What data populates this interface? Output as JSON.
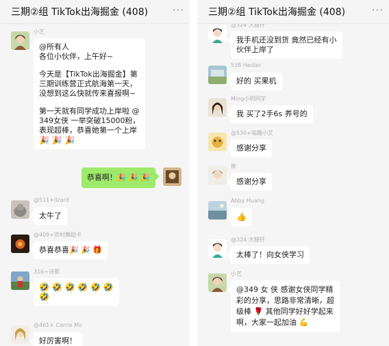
{
  "left": {
    "title": "三期②组 TikTok出海掘金 (408)",
    "more_label": "···",
    "messages": [
      {
        "sender": "小艺",
        "lines": [
          "@所有人",
          "各位小伙伴，上午好~",
          "",
          "今天是【TikTok出海掘金】第",
          "三期训练营正式航海第一天，",
          "没想到这么快就传来喜报啊~",
          "",
          "第一天就有同学成功上岸啦 @",
          "349女侠 一举突破15000粉，",
          "表现超棒，恭喜她第一个上岸"
        ],
        "emoji": "🎉 🎉 🎉"
      },
      {
        "text": "恭喜啊！🎉 🎉 🎉"
      },
      {
        "sender": "@511+lizard",
        "text": "太牛了"
      },
      {
        "sender": "@409+农村舞蹈卡",
        "text": "恭喜恭喜🎉 🎉 🎁"
      },
      {
        "sender": "316+诗那",
        "line1": "🤣 🤣 🤣 🤣 🤣 🤣",
        "line2": "🤣"
      },
      {
        "sender": "@461+ Carrie Mo",
        "text": "好厉害啊！"
      }
    ]
  },
  "right": {
    "title": "三期②组 TikTok出海掘金 (408)",
    "more_label": "···",
    "messages": [
      {
        "sender": "@324 大豁钎",
        "lines": [
          "我手机还没到货 竟然已经有小",
          "伙伴上岸了"
        ]
      },
      {
        "sender": "538 Hester",
        "text": "好的 买果机"
      },
      {
        "sender": "Ming小明同学",
        "text": "我 买了2手6s 养号的"
      },
      {
        "sender": "@530+喵趣小艾",
        "text": "感谢分享"
      },
      {
        "sender": "筱",
        "text": "感谢分享"
      },
      {
        "sender": "Abby Huang",
        "text": "👍"
      },
      {
        "sender": "@324 大豁钎",
        "text": "太棒了！向女侠学习"
      },
      {
        "sender": "小艺",
        "lines": [
          "@349 女 侠 感谢女侠同学精",
          "彩的分享，思路非常清晰，超",
          "级棒 🌹 其他同学好好学起来",
          "啊，大家一起加油 💪"
        ]
      }
    ]
  },
  "colors": {
    "self_bubble": "#9eea6a",
    "panel_bg": "#f5f5f5"
  }
}
